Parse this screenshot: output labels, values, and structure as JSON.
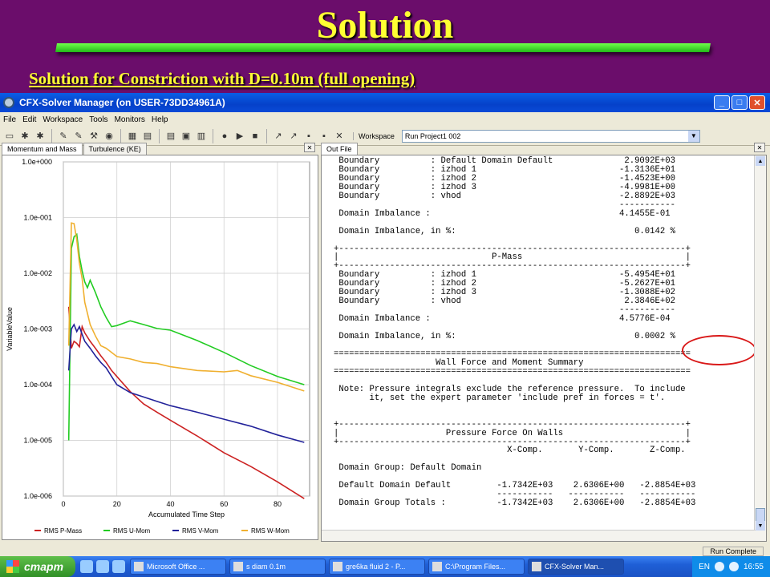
{
  "slide": {
    "title": "Solution",
    "subtitle": "Solution for Constriction with D=0.10m (full opening)"
  },
  "window": {
    "title": "CFX-Solver Manager (on USER-73DD34961A)",
    "menu": [
      "File",
      "Edit",
      "Workspace",
      "Tools",
      "Monitors",
      "Help"
    ],
    "workspace_label": "Workspace",
    "workspace_value": "Run Project1 002",
    "status": "Run Complete"
  },
  "left_tabs": [
    "Momentum and Mass",
    "Turbulence (KE)"
  ],
  "right_tabs": [
    "Out File"
  ],
  "chart_data": {
    "type": "line",
    "xlabel": "Accumulated Time Step",
    "ylabel": "VariableValue",
    "yscale": "log",
    "xlim": [
      0,
      92
    ],
    "ylim": [
      1e-06,
      1
    ],
    "xticks": [
      "0",
      "20",
      "40",
      "60",
      "80"
    ],
    "yticks": [
      "1.0e-006",
      "1.0e-005",
      "1.0e-004",
      "1.0e-003",
      "1.0e-002",
      "1.0e-001",
      "1.0e+000"
    ],
    "grid": true,
    "legend": "bottom",
    "series": [
      {
        "name": "RMS P-Mass",
        "color": "#cc2222",
        "x": [
          2,
          3,
          4,
          5,
          6,
          7,
          8,
          10,
          12,
          14,
          16,
          18,
          20,
          25,
          30,
          35,
          40,
          50,
          60,
          70,
          80,
          90
        ],
        "y": [
          0.0025,
          0.00045,
          0.0006,
          0.00055,
          0.00048,
          0.0011,
          0.00085,
          0.0006,
          0.00045,
          0.00033,
          0.00025,
          0.00018,
          0.00014,
          7.5e-05,
          4.5e-05,
          3.2e-05,
          2.3e-05,
          1.2e-05,
          6e-06,
          3.4e-06,
          1.8e-06,
          9e-07
        ]
      },
      {
        "name": "RMS U-Mom",
        "color": "#22cc22",
        "x": [
          2,
          3,
          4,
          5,
          6,
          7,
          8,
          9,
          10,
          12,
          14,
          16,
          18,
          20,
          25,
          30,
          35,
          40,
          50,
          60,
          70,
          80,
          90
        ],
        "y": [
          1e-05,
          0.028,
          0.045,
          0.05,
          0.02,
          0.011,
          0.007,
          0.0055,
          0.0075,
          0.0045,
          0.0025,
          0.0016,
          0.0011,
          0.00115,
          0.0014,
          0.0012,
          0.00102,
          0.00095,
          0.00062,
          0.00038,
          0.00022,
          0.00014,
          0.0001
        ]
      },
      {
        "name": "RMS V-Mom",
        "color": "#22229a",
        "x": [
          2,
          3,
          4,
          5,
          6,
          7,
          8,
          10,
          12,
          14,
          16,
          18,
          20,
          25,
          30,
          35,
          40,
          50,
          60,
          70,
          80,
          90
        ],
        "y": [
          0.00018,
          0.001,
          0.0012,
          0.0009,
          0.0011,
          0.0008,
          0.0006,
          0.00045,
          0.00033,
          0.00025,
          0.0002,
          0.00014,
          0.0001,
          7.2e-05,
          6e-05,
          5e-05,
          4.2e-05,
          3.2e-05,
          2.4e-05,
          1.8e-05,
          1.25e-05,
          9.2e-06
        ]
      },
      {
        "name": "RMS W-Mom",
        "color": "#f0b030",
        "x": [
          2,
          3,
          4,
          5,
          6,
          7,
          8,
          10,
          12,
          14,
          16,
          18,
          20,
          25,
          30,
          35,
          40,
          50,
          60,
          65,
          70,
          80,
          90
        ],
        "y": [
          0.0005,
          0.08,
          0.078,
          0.04,
          0.015,
          0.008,
          0.003,
          0.0012,
          0.00075,
          0.0005,
          0.00045,
          0.00038,
          0.00032,
          0.00029,
          0.00025,
          0.00024,
          0.00021,
          0.00018,
          0.00017,
          0.00018,
          0.000145,
          0.00011,
          7.7e-05
        ]
      }
    ]
  },
  "out_file": {
    "lines": [
      " Boundary          : Default Domain Default              2.9092E+03",
      " Boundary          : izhod 1                            -1.3136E+01",
      " Boundary          : izhod 2                            -1.4523E+00",
      " Boundary          : izhod 3                            -4.9981E+00",
      " Boundary          : vhod                               -2.8892E+03",
      "                                                        -----------",
      " Domain Imbalance :                                     4.1455E-01",
      "",
      " Domain Imbalance, in %:                                   0.0142 %",
      "",
      "+--------------------------------------------------------------------+",
      "|                              P-Mass                                |",
      "+--------------------------------------------------------------------+",
      " Boundary          : izhod 1                            -5.4954E+01",
      " Boundary          : izhod 2                            -5.2627E+01",
      " Boundary          : izhod 3                            -1.3088E+02",
      " Boundary          : vhod                                2.3846E+02",
      "                                                        -----------",
      " Domain Imbalance :                                     4.5776E-04",
      "",
      " Domain Imbalance, in %:                                   0.0002 %",
      "",
      "======================================================================",
      "                    Wall Force and Moment Summary",
      "======================================================================",
      "",
      " Note: Pressure integrals exclude the reference pressure.  To include",
      "       it, set the expert parameter 'include pref in forces = t'.",
      "",
      "",
      "+--------------------------------------------------------------------+",
      "|                     Pressure Force On Walls                        |",
      "+--------------------------------------------------------------------+",
      "                                  X-Comp.       Y-Comp.       Z-Comp.",
      "",
      " Domain Group: Default Domain",
      "",
      " Default Domain Default         -1.7342E+03    2.6306E+00   -2.8854E+03",
      "                                -----------   -----------   -----------",
      " Domain Group Totals :          -1.7342E+03    2.6306E+00   -2.8854E+03"
    ]
  },
  "taskbar": {
    "start": "старт",
    "tasks": [
      "Microsoft Office ...",
      "s diam 0.1m",
      "gre6ka fluid 2 - P...",
      "C:\\Program Files...",
      "CFX-Solver Man..."
    ],
    "lang": "EN",
    "clock": "16:55"
  }
}
